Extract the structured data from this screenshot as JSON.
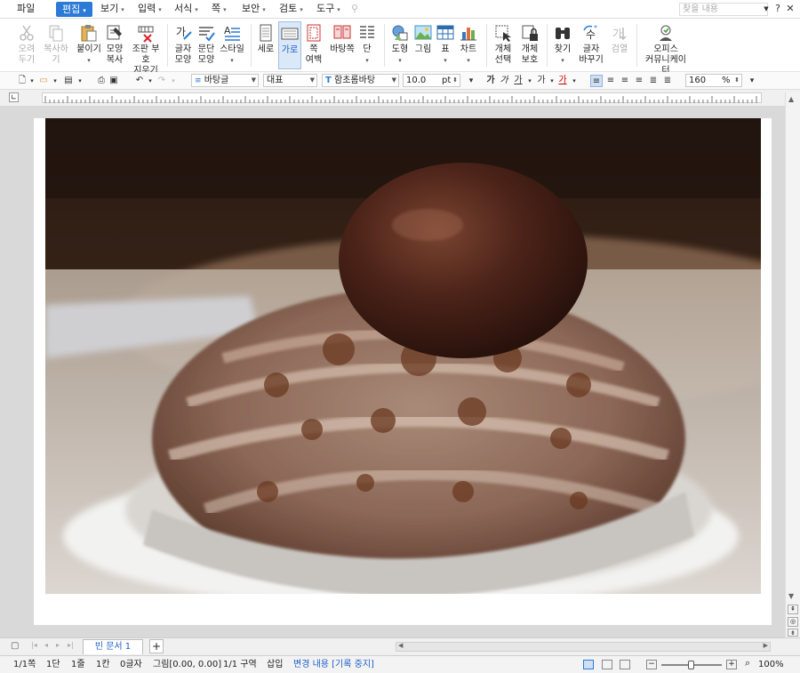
{
  "menubar": {
    "items": [
      "파일",
      "편집",
      "보기",
      "입력",
      "서식",
      "쪽",
      "보안",
      "검토",
      "도구"
    ],
    "active": "편집",
    "find_placeholder": "찾을 내용"
  },
  "ribbon": {
    "groups": [
      {
        "label": "오려\n두기",
        "icon": "scissors-icon",
        "disabled": true
      },
      {
        "label": "복사하기",
        "icon": "copy-icon",
        "disabled": true
      },
      {
        "label": "붙이기",
        "icon": "paste-icon"
      },
      {
        "label": "모양\n복사",
        "icon": "format-painter-icon"
      },
      {
        "label": "조판 부호\n지우기",
        "icon": "clear-marks-icon"
      },
      {
        "label": "글자\n모양",
        "icon": "char-shape-icon"
      },
      {
        "label": "문단\n모양",
        "icon": "para-shape-icon"
      },
      {
        "label": "스타일",
        "icon": "style-icon"
      },
      {
        "label": "세로",
        "icon": "portrait-icon"
      },
      {
        "label": "가로",
        "icon": "landscape-icon",
        "active": true
      },
      {
        "label": "쪽\n여백",
        "icon": "page-margin-icon"
      },
      {
        "label": "바탕쪽",
        "icon": "master-page-icon"
      },
      {
        "label": "단",
        "icon": "columns-icon"
      },
      {
        "label": "도형",
        "icon": "shapes-icon"
      },
      {
        "label": "그림",
        "icon": "picture-icon"
      },
      {
        "label": "표",
        "icon": "table-icon"
      },
      {
        "label": "차트",
        "icon": "chart-icon"
      },
      {
        "label": "개체\n선택",
        "icon": "select-object-icon"
      },
      {
        "label": "개체\n보호",
        "icon": "protect-object-icon"
      },
      {
        "label": "찾기",
        "icon": "binoculars-icon"
      },
      {
        "label": "글자\n바꾸기",
        "icon": "replace-icon"
      },
      {
        "label": "검열",
        "icon": "censor-icon",
        "disabled": true
      },
      {
        "label": "오피스\n커뮤니케이터",
        "icon": "communicator-icon"
      }
    ]
  },
  "toolbar2": {
    "style": "바탕글",
    "lang": "대표",
    "font": "함초롬바탕",
    "size": "10.0",
    "unit": "pt",
    "zoom": "160",
    "zoom_unit": "%",
    "chars": [
      "가",
      "가",
      "가",
      "가",
      "가"
    ]
  },
  "tabs": {
    "doc": "빈 문서 1",
    "add": "+"
  },
  "status": {
    "page": "1/1쪽",
    "section": "1단",
    "line": "1줄",
    "col": "1칸",
    "chars": "0글자",
    "obj": "그림[0.00, 0.00]",
    "area": "1/1 구역",
    "mode": "삽입",
    "track": "변경 내용 [기록 중지]",
    "zoom": "100%"
  },
  "colors": {
    "accent": "#2b7bd6",
    "tab_text": "#1e5fc7"
  }
}
